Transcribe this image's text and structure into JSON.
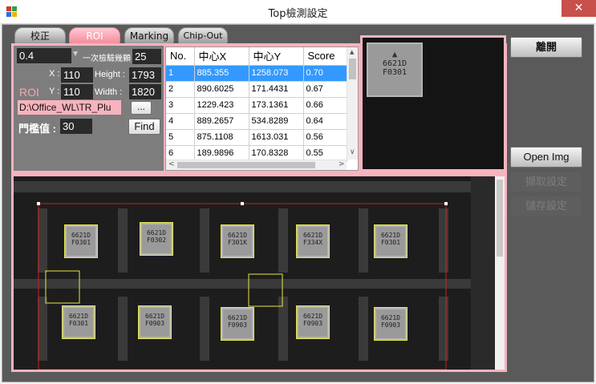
{
  "window": {
    "title": "Top檢測設定",
    "close_glyph": "✕"
  },
  "tabs": [
    {
      "label": "校正"
    },
    {
      "label": "ROI"
    },
    {
      "label": "Marking"
    },
    {
      "label": "Chip-Out"
    }
  ],
  "params": {
    "score_value": "0.4",
    "dropdown_glyph": "▼",
    "count_label": "一次檢驗幾顆",
    "count_value": "25",
    "x_label": "X :",
    "x_value": "110",
    "height_label": "Height :",
    "height_value": "1793",
    "roi_label": "ROI",
    "y_label": "Y :",
    "y_value": "110",
    "width_label": "Width :",
    "width_value": "1820",
    "path_value": "D:\\Office_WL\\TR_Plu",
    "browse_label": "...",
    "threshold_label": "門檻值 :",
    "threshold_value": "30",
    "find_label": "Find"
  },
  "results": {
    "columns": [
      "No.",
      "中心X",
      "中心Y",
      "Score"
    ],
    "rows": [
      [
        "1",
        "885.355",
        "1258.073",
        "0.70"
      ],
      [
        "2",
        "890.6025",
        "171.4431",
        "0.67"
      ],
      [
        "3",
        "1229.423",
        "173.1361",
        "0.66"
      ],
      [
        "4",
        "889.2657",
        "534.8289",
        "0.64"
      ],
      [
        "5",
        "875.1108",
        "1613.031",
        "0.56"
      ],
      [
        "6",
        "189.9896",
        "170.8328",
        "0.55"
      ]
    ],
    "selected_row": 1,
    "scroll_up": "▲",
    "scroll_down": "∨",
    "scroll_left": "<",
    "scroll_right": ">"
  },
  "template_chip": {
    "line1": "6621D",
    "line2": "F0301"
  },
  "side_buttons": {
    "leave": "離開",
    "open_img": "Open Img",
    "capture": "擷取設定",
    "save": "儲存設定"
  },
  "chips": [
    {
      "l1": "6621D",
      "l2": "F0301"
    },
    {
      "l1": "6621D",
      "l2": "F0302"
    },
    {
      "l1": "6621D",
      "l2": "F301K"
    },
    {
      "l1": "6621D",
      "l2": "F334X"
    },
    {
      "l1": "6621D",
      "l2": "F0301"
    },
    {
      "l1": "6621D",
      "l2": "F0301"
    },
    {
      "l1": "6621D",
      "l2": "F0903"
    },
    {
      "l1": "6621D",
      "l2": "F0903"
    },
    {
      "l1": "6621D",
      "l2": "F0903"
    },
    {
      "l1": "6621D",
      "l2": "F0903"
    }
  ],
  "colors": {
    "accent_pink": "#f7b3be",
    "selection_blue": "#3399ff",
    "detection_yellow": "#e8e848",
    "roi_red": "#d02020"
  }
}
